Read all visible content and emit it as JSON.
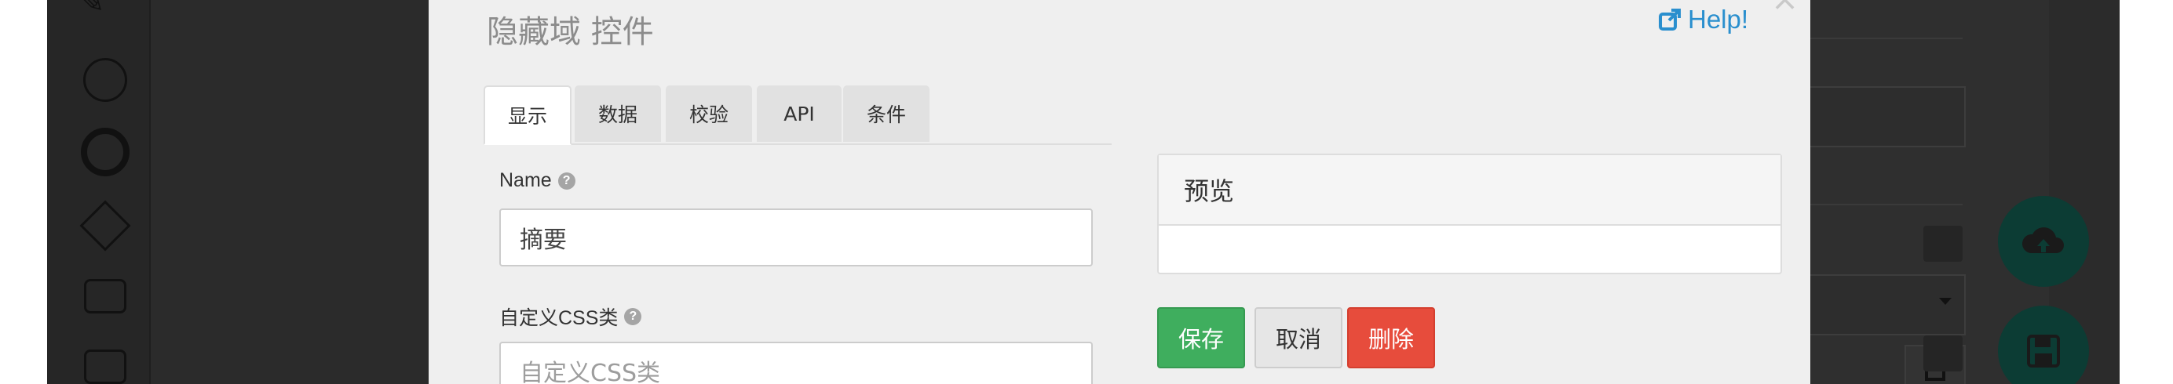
{
  "modal": {
    "title": "隐藏域 控件",
    "help_label": "Help!",
    "tabs": [
      {
        "label": "显示",
        "active": true
      },
      {
        "label": "数据",
        "active": false
      },
      {
        "label": "校验",
        "active": false
      },
      {
        "label": "API",
        "active": false
      },
      {
        "label": "条件",
        "active": false
      }
    ],
    "fields": {
      "name": {
        "label": "Name",
        "value": "摘要"
      },
      "css_class": {
        "label": "自定义CSS类",
        "placeholder": "自定义CSS类"
      }
    },
    "preview": {
      "title": "预览"
    },
    "buttons": {
      "save": "保存",
      "cancel": "取消",
      "delete": "删除"
    }
  },
  "icons": {
    "help": "external-link-icon",
    "tooltip": "question-circle-icon",
    "close": "close-icon",
    "upload": "cloud-upload-icon",
    "save": "floppy-disk-icon",
    "calendar": "calendar-icon",
    "dropdown": "caret-down-icon"
  },
  "colors": {
    "save_button": "#3fae5e",
    "delete_button": "#e74c3c",
    "help_link": "#2a8fce",
    "fab": "#0c3c34"
  }
}
